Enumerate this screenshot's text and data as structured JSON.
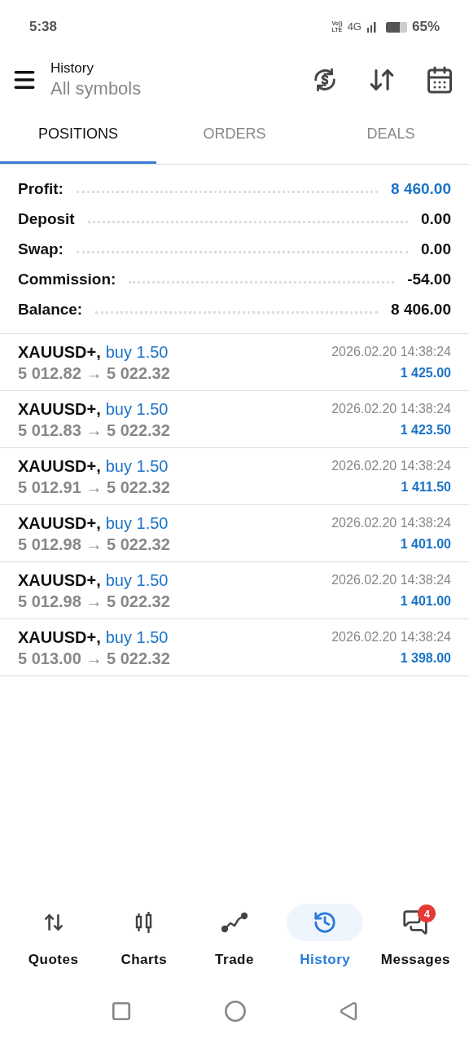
{
  "status_bar": {
    "time": "5:38",
    "network_top": "Vo))",
    "network_bottom": "LTE",
    "network_type": "4G",
    "battery": "65%"
  },
  "header": {
    "title": "History",
    "subtitle": "All symbols"
  },
  "tabs": [
    {
      "label": "POSITIONS",
      "selected": true
    },
    {
      "label": "ORDERS",
      "selected": false
    },
    {
      "label": "DEALS",
      "selected": false
    }
  ],
  "summary": [
    {
      "label": "Profit:",
      "value": "8 460.00",
      "highlighted": true
    },
    {
      "label": "Deposit",
      "value": "0.00",
      "highlighted": false
    },
    {
      "label": "Swap:",
      "value": "0.00",
      "highlighted": false
    },
    {
      "label": "Commission:",
      "value": "-54.00",
      "highlighted": false
    },
    {
      "label": "Balance:",
      "value": "8 406.00",
      "highlighted": false
    }
  ],
  "positions": [
    {
      "symbol": "XAUUSD+,",
      "side": "buy 1.50",
      "prices": "5 012.82 → 5 022.32",
      "time": "2026.02.20 14:38:24",
      "profit": "1 425.00"
    },
    {
      "symbol": "XAUUSD+,",
      "side": "buy 1.50",
      "prices": "5 012.83 → 5 022.32",
      "time": "2026.02.20 14:38:24",
      "profit": "1 423.50"
    },
    {
      "symbol": "XAUUSD+,",
      "side": "buy 1.50",
      "prices": "5 012.91 → 5 022.32",
      "time": "2026.02.20 14:38:24",
      "profit": "1 411.50"
    },
    {
      "symbol": "XAUUSD+,",
      "side": "buy 1.50",
      "prices": "5 012.98 → 5 022.32",
      "time": "2026.02.20 14:38:24",
      "profit": "1 401.00"
    },
    {
      "symbol": "XAUUSD+,",
      "side": "buy 1.50",
      "prices": "5 012.98 → 5 022.32",
      "time": "2026.02.20 14:38:24",
      "profit": "1 401.00"
    },
    {
      "symbol": "XAUUSD+,",
      "side": "buy 1.50",
      "prices": "5 013.00 → 5 022.32",
      "time": "2026.02.20 14:38:24",
      "profit": "1 398.00"
    }
  ],
  "bottom_nav": [
    {
      "kind": "quotes",
      "label": "Quotes",
      "selected": false
    },
    {
      "kind": "charts",
      "label": "Charts",
      "selected": false
    },
    {
      "kind": "trade",
      "label": "Trade",
      "selected": false
    },
    {
      "kind": "history",
      "label": "History",
      "selected": true
    },
    {
      "kind": "messages",
      "label": "Messages",
      "selected": false,
      "badge": "4"
    }
  ]
}
